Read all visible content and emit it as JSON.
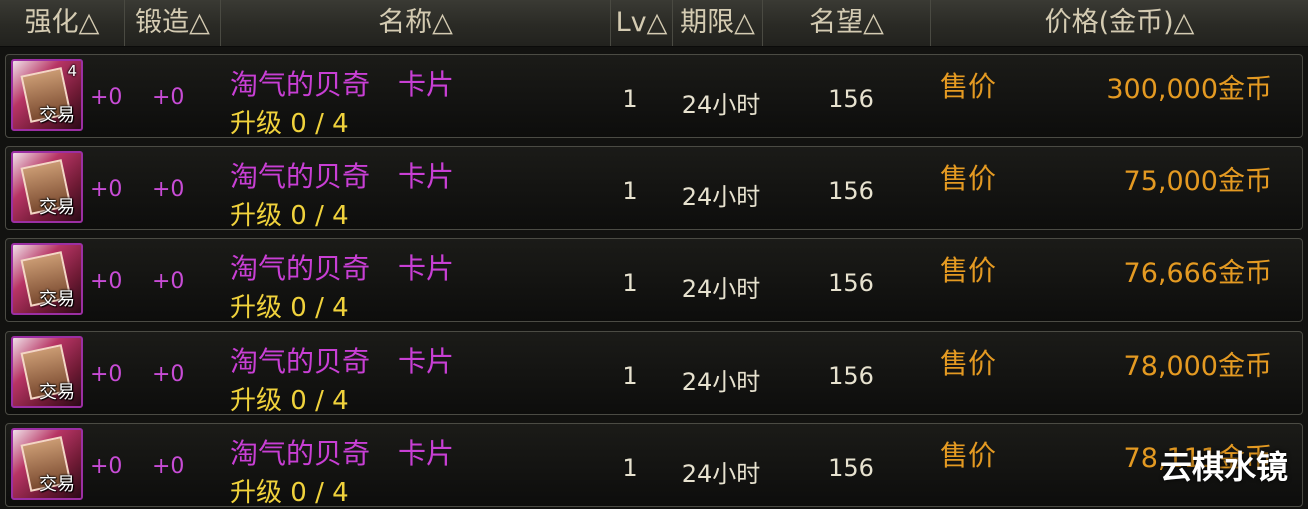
{
  "header": {
    "col_enhance": "强化△",
    "col_forge": "锻造△",
    "col_name": "名称△",
    "col_lv": "Lv△",
    "col_period": "期限△",
    "col_fame": "名望△",
    "col_price": "价格(金币)△"
  },
  "rows": [
    {
      "icon": "card-icon",
      "icon_count": "4",
      "trade": "交易",
      "enhance": "+0",
      "forge": "+0",
      "name": "淘气的贝奇　卡片",
      "upgrade": "升级 0 / 4",
      "lv": "1",
      "period": "24小时",
      "fame": "156",
      "sale_label": "售价",
      "price": "300,000金币"
    },
    {
      "icon": "card-icon",
      "icon_count": "",
      "trade": "交易",
      "enhance": "+0",
      "forge": "+0",
      "name": "淘气的贝奇　卡片",
      "upgrade": "升级 0 / 4",
      "lv": "1",
      "period": "24小时",
      "fame": "156",
      "sale_label": "售价",
      "price": "75,000金币"
    },
    {
      "icon": "card-icon",
      "icon_count": "",
      "trade": "交易",
      "enhance": "+0",
      "forge": "+0",
      "name": "淘气的贝奇　卡片",
      "upgrade": "升级 0 / 4",
      "lv": "1",
      "period": "24小时",
      "fame": "156",
      "sale_label": "售价",
      "price": "76,666金币"
    },
    {
      "icon": "card-icon",
      "icon_count": "",
      "trade": "交易",
      "enhance": "+0",
      "forge": "+0",
      "name": "淘气的贝奇　卡片",
      "upgrade": "升级 0 / 4",
      "lv": "1",
      "period": "24小时",
      "fame": "156",
      "sale_label": "售价",
      "price": "78,000金币"
    },
    {
      "icon": "card-icon",
      "icon_count": "",
      "trade": "交易",
      "enhance": "+0",
      "forge": "+0",
      "name": "淘气的贝奇　卡片",
      "upgrade": "升级 0 / 4",
      "lv": "1",
      "period": "24小时",
      "fame": "156",
      "sale_label": "售价",
      "price": "78,111金币"
    }
  ],
  "watermark": "云棋水镜",
  "colors": {
    "name": "#c83fd4",
    "upgrade": "#f0d23c",
    "price": "#e49a22",
    "plus": "#c84cd6"
  }
}
